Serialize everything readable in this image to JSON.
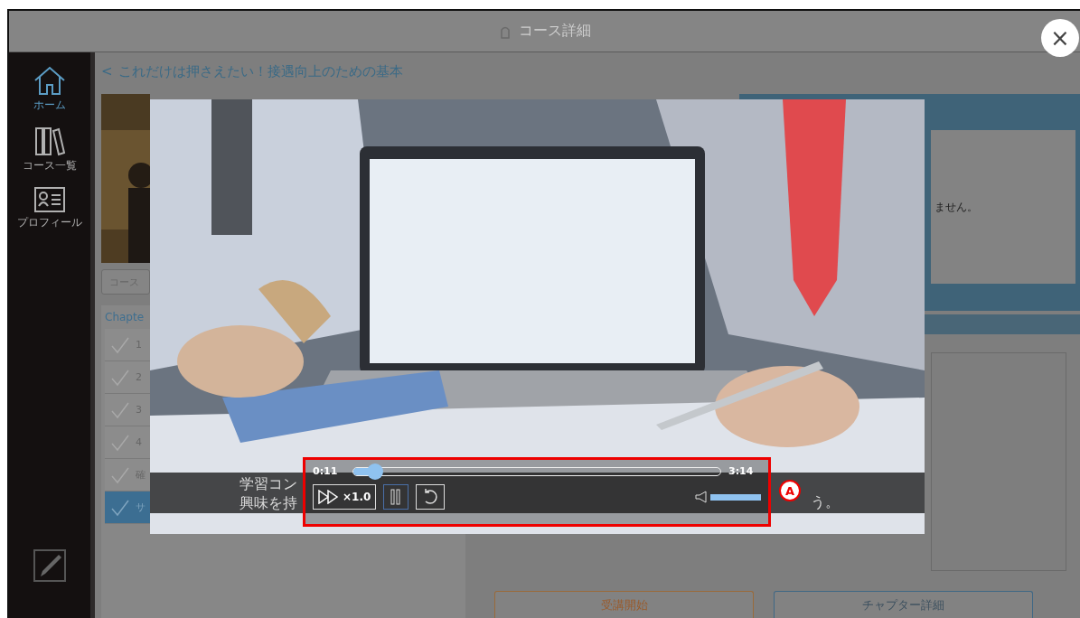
{
  "header": {
    "title": "コース詳細"
  },
  "sidebar": {
    "items": [
      {
        "label": "ホーム",
        "selected": true
      },
      {
        "label": "コース一覧",
        "selected": false
      },
      {
        "label": "プロフィール",
        "selected": false
      }
    ]
  },
  "course": {
    "title": "これだけは押さえたい！接遇向上のための基本",
    "back": "<",
    "search_placeholder": "コース",
    "chapter_heading": "Chapte"
  },
  "chapters": [
    {
      "label": "1",
      "selected": false
    },
    {
      "label": "2",
      "selected": false
    },
    {
      "label": "3",
      "selected": false
    },
    {
      "label": "4",
      "selected": false
    },
    {
      "label": "確",
      "selected": false
    },
    {
      "label": "サ",
      "selected": true
    }
  ],
  "info_panel": {
    "text": "ません。"
  },
  "buttons": [
    {
      "label": "受講開始",
      "kind": "primary"
    },
    {
      "label": "チャプター詳細",
      "kind": "secondary"
    }
  ],
  "video": {
    "kind": "picture",
    "subtitles": [
      "学習コン",
      "興味を持"
    ],
    "subtitle_end": "う。",
    "controls": {
      "current_time": "0:11",
      "duration": "3:14",
      "level": 0.06,
      "speed": "×1.0",
      "playing": true,
      "volume": {
        "level": 1
      }
    }
  },
  "annotation": {
    "label": "A"
  },
  "close": "×"
}
